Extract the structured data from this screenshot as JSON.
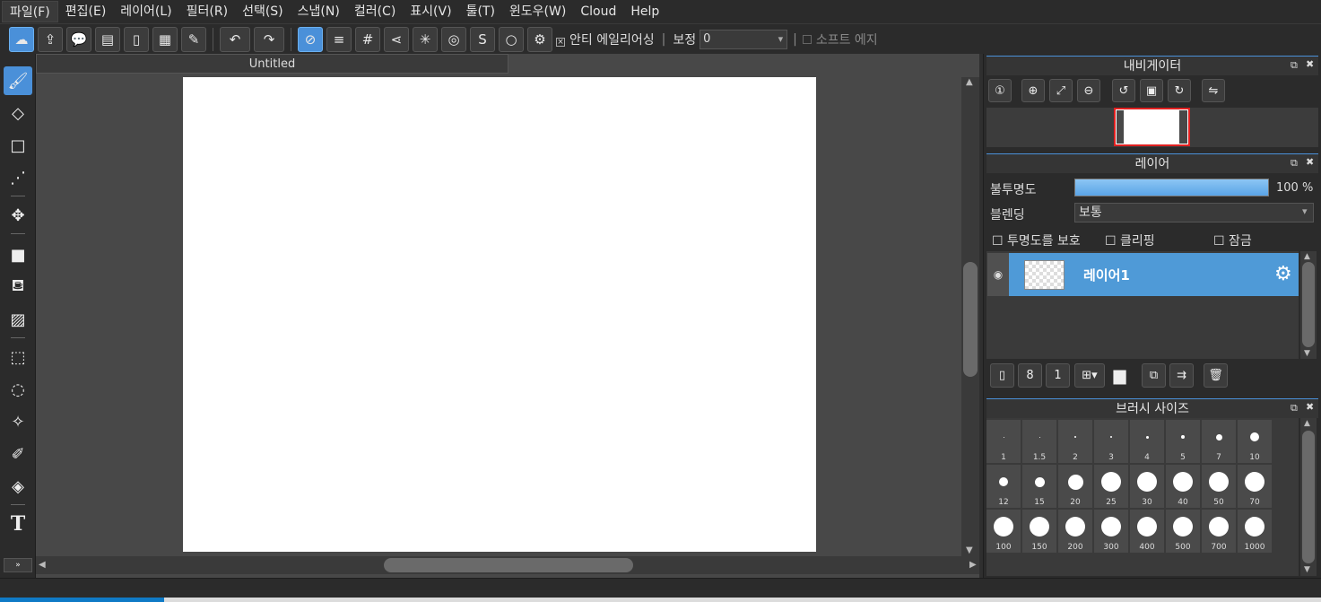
{
  "menu": {
    "items": [
      {
        "label": "파일(F)"
      },
      {
        "label": "편집(E)"
      },
      {
        "label": "레이어(L)"
      },
      {
        "label": "필터(R)"
      },
      {
        "label": "선택(S)"
      },
      {
        "label": "스냅(N)"
      },
      {
        "label": "컬러(C)"
      },
      {
        "label": "표시(V)"
      },
      {
        "label": "툴(T)"
      },
      {
        "label": "윈도우(W)"
      },
      {
        "label": "Cloud"
      },
      {
        "label": "Help"
      }
    ]
  },
  "toolbar": {
    "antialias_label": "안티 에일리어싱",
    "antialias_checked": true,
    "correction_label": "보정",
    "correction_value": "0",
    "soft_edge_label": "소프트 에지",
    "soft_edge_checked": false
  },
  "document": {
    "tab_title": "Untitled"
  },
  "navigator": {
    "title": "내비게이터"
  },
  "layers": {
    "title": "레이어",
    "opacity_label": "불투명도",
    "opacity_value": "100 %",
    "opacity": 1.0,
    "blending_label": "블렌딩",
    "blending_value": "보통",
    "protect_alpha_label": "투명도를 보호",
    "clipping_label": "클리핑",
    "lock_label": "잠금",
    "items": [
      {
        "name": "레이어1"
      }
    ]
  },
  "brush_size": {
    "title": "브러시 사이즈",
    "sizes": [
      "1",
      "1.5",
      "2",
      "3",
      "4",
      "5",
      "7",
      "10",
      "12",
      "15",
      "20",
      "25",
      "30",
      "40",
      "50",
      "70",
      "100",
      "150",
      "200",
      "300",
      "400",
      "500",
      "700",
      "1000"
    ]
  },
  "colors": {
    "accent": "#4a90d9",
    "selected_layer": "#4f9ad7",
    "background": "#2b2b2b",
    "canvas_bg": "#484848"
  }
}
